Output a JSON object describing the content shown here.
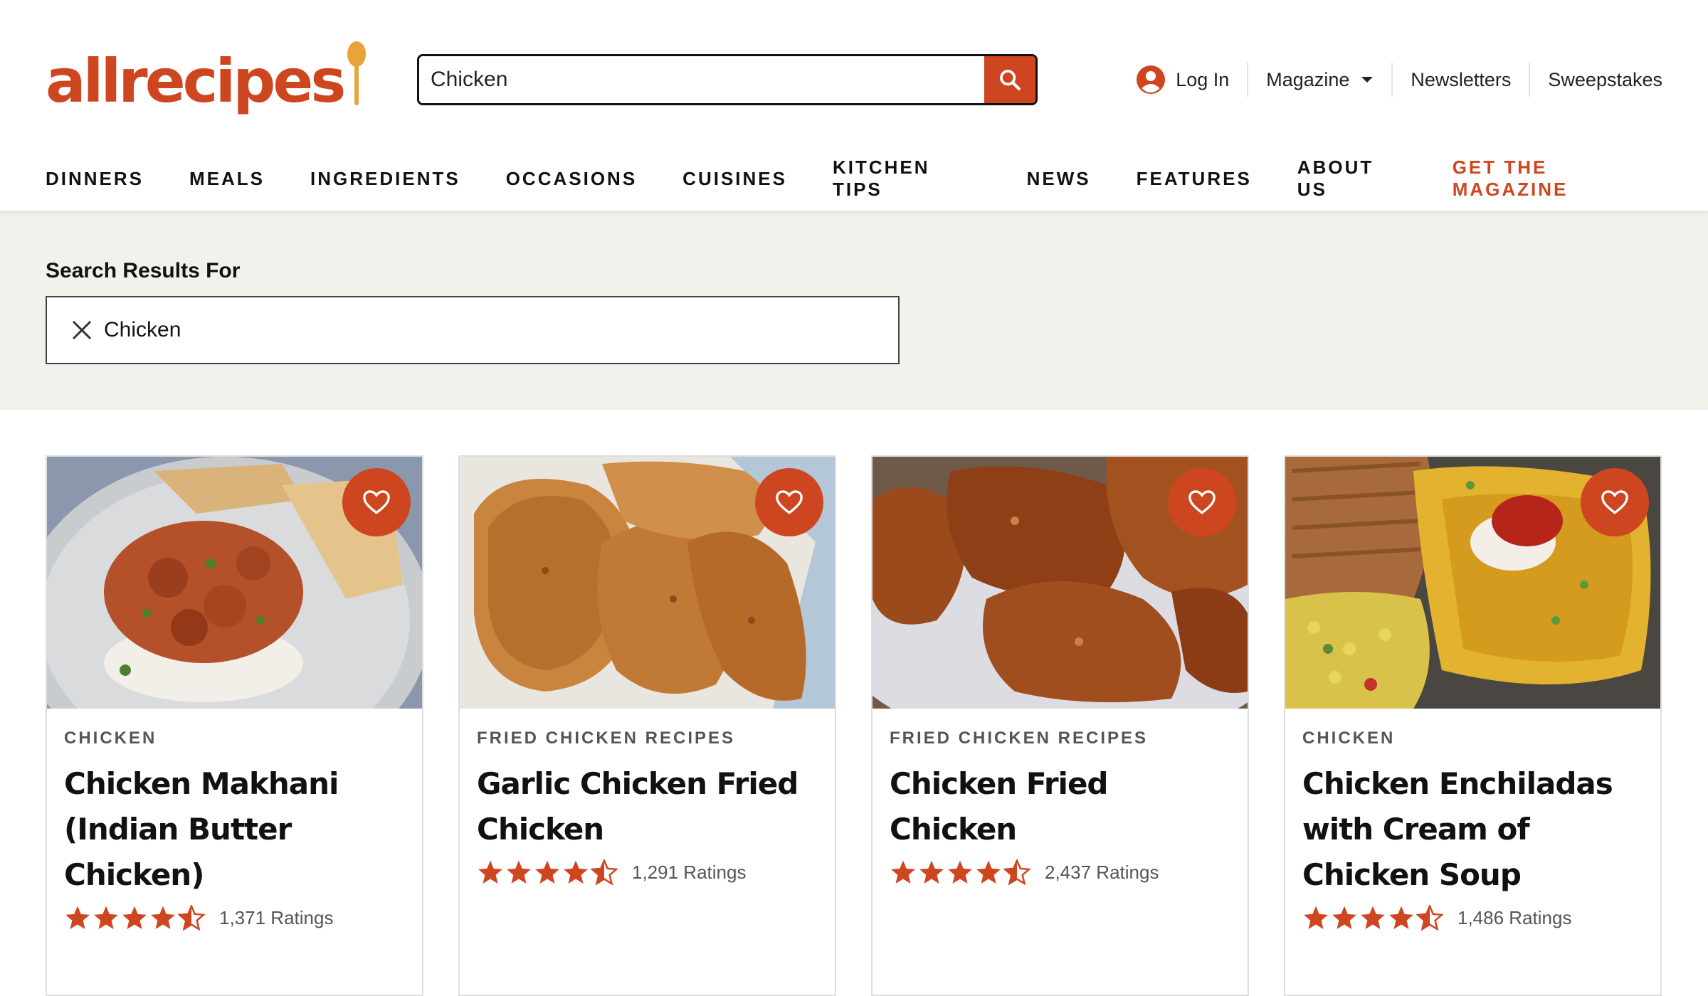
{
  "brand": {
    "name": "allrecipes",
    "accent_color": "#ce4620"
  },
  "search": {
    "value": "Chicken",
    "icon": "search-icon"
  },
  "utility_nav": {
    "login_label": "Log In",
    "login_icon": "user-circle-icon",
    "magazine_label": "Magazine",
    "magazine_icon": "caret-down-icon",
    "newsletters_label": "Newsletters",
    "sweepstakes_label": "Sweepstakes"
  },
  "main_nav": {
    "items": [
      {
        "label": "DINNERS"
      },
      {
        "label": "MEALS"
      },
      {
        "label": "INGREDIENTS"
      },
      {
        "label": "OCCASIONS"
      },
      {
        "label": "CUISINES"
      },
      {
        "label": "KITCHEN TIPS"
      },
      {
        "label": "NEWS"
      },
      {
        "label": "FEATURES"
      },
      {
        "label": "ABOUT US"
      }
    ],
    "cta_label": "GET THE MAGAZINE"
  },
  "results": {
    "heading": "Search Results For",
    "chip_label": "Chicken",
    "chip_icon": "close-icon"
  },
  "cards": [
    {
      "category": "CHICKEN",
      "title": "Chicken Makhani (Indian Butter Chicken)",
      "rating": 4.5,
      "ratings_label": "1,371 Ratings",
      "image": "chicken-makhani-photo"
    },
    {
      "category": "FRIED CHICKEN RECIPES",
      "title": "Garlic Chicken Fried Chicken",
      "rating": 4.5,
      "ratings_label": "1,291 Ratings",
      "image": "garlic-fried-chicken-photo"
    },
    {
      "category": "FRIED CHICKEN RECIPES",
      "title": "Chicken Fried Chicken",
      "rating": 4.5,
      "ratings_label": "2,437 Ratings",
      "image": "chicken-fried-chicken-photo"
    },
    {
      "category": "CHICKEN",
      "title": "Chicken Enchiladas with Cream of Chicken Soup",
      "rating": 4.5,
      "ratings_label": "1,486 Ratings",
      "image": "chicken-enchiladas-photo"
    }
  ]
}
